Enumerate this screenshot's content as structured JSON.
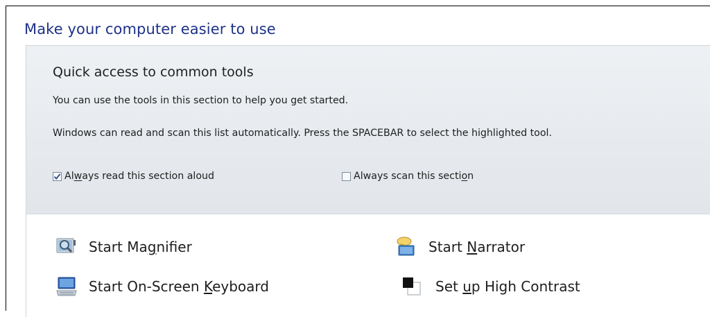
{
  "page": {
    "title": "Make your computer easier to use"
  },
  "quick_access": {
    "title": "Quick access to common tools",
    "description": "You can use the tools in this section to help you get started.",
    "instruction": "Windows can read and scan this list automatically.  Press the SPACEBAR to select the highlighted tool.",
    "read_aloud": {
      "pre": "Al",
      "key": "w",
      "post": "ays read this section aloud",
      "checked": true
    },
    "scan": {
      "pre": "Always scan this secti",
      "key": "o",
      "post": "n",
      "checked": false
    }
  },
  "tools": {
    "magnifier": {
      "pre": "Start Ma",
      "key": "g",
      "post": "nifier",
      "icon": "magnifier-icon"
    },
    "narrator": {
      "pre": "Start ",
      "key": "N",
      "post": "arrator",
      "icon": "narrator-icon"
    },
    "keyboard": {
      "pre": "Start On-Screen ",
      "key": "K",
      "post": "eyboard",
      "icon": "on-screen-keyboard-icon"
    },
    "contrast": {
      "pre": "Set ",
      "key": "u",
      "post": "p High Contrast",
      "icon": "high-contrast-icon"
    }
  },
  "colors": {
    "title": "#1e3287",
    "panel": "#e6eaee",
    "text": "#1e1e1e"
  }
}
